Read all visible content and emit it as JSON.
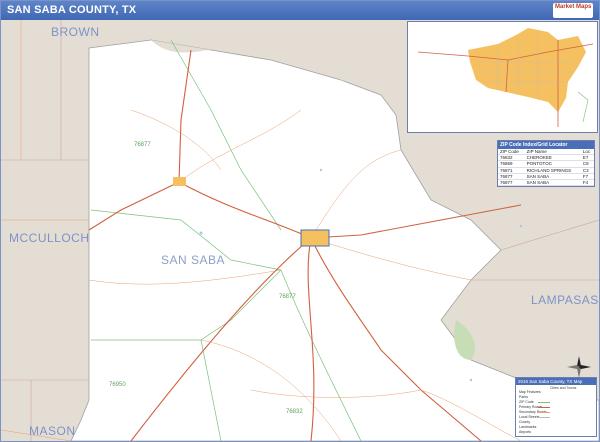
{
  "header": {
    "title": "SAN SABA COUNTY, TX",
    "logo_text": "Market Maps"
  },
  "map": {
    "county_name": "SAN SABA",
    "neighbors": [
      "BROWN",
      "MCCULLOCH",
      "LAMPASAS",
      "MASON"
    ],
    "zip_labels": [
      "76877",
      "76877",
      "76950",
      "76832"
    ],
    "colors": {
      "county_land": "#ffffff",
      "outside_land": "#e3ddd3",
      "water": "#a8c8e8",
      "highway": "#d06040",
      "road": "#e8a070",
      "zip_boundary": "#7cc07c",
      "town": "#f5c060",
      "accent": "#4a6fb8"
    }
  },
  "zip_table": {
    "title": "ZIP Code Index/Grid Locator",
    "columns": [
      "ZIP Code",
      "ZIP Name",
      "Loc"
    ],
    "rows": [
      [
        "76832",
        "CHEROKEE",
        "E7"
      ],
      [
        "76869",
        "PONTOTOC",
        "C8"
      ],
      [
        "76871",
        "RICHLAND SPRINGS",
        "C3"
      ],
      [
        "76877",
        "SAN SABA",
        "F7"
      ],
      [
        "76877",
        "SAN SABA",
        "F4"
      ]
    ]
  },
  "legend": {
    "title": "2016 San Saba County, TX Map",
    "subtitle": "Cities and Towns",
    "rows": [
      {
        "label": "Map Features"
      },
      {
        "label": "Parks"
      },
      {
        "label": "ZIP Code"
      },
      {
        "label": "Primary Roads"
      },
      {
        "label": "Secondary Roads"
      },
      {
        "label": "Local Streets"
      },
      {
        "label": "County"
      },
      {
        "label": "Landmarks"
      },
      {
        "label": "Airports"
      }
    ]
  }
}
